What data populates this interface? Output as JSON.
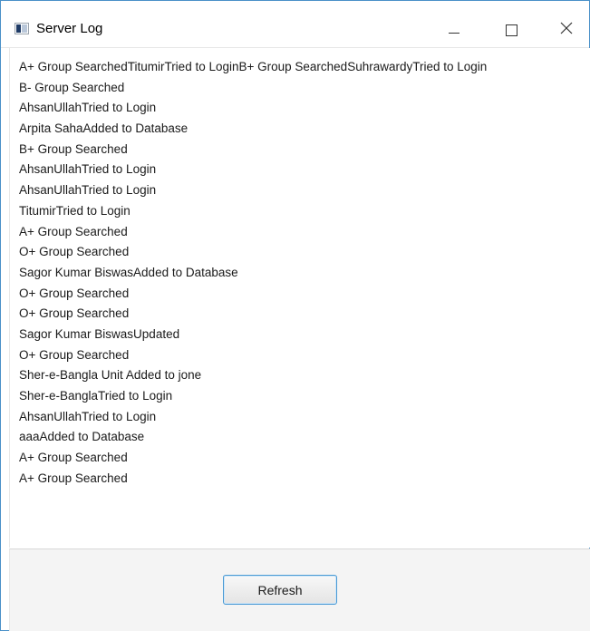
{
  "window": {
    "title": "Server Log"
  },
  "log": {
    "lines": [
      "A+ Group SearchedTitumirTried to LoginB+ Group SearchedSuhrawardyTried to Login",
      "B- Group Searched",
      "AhsanUllahTried to Login",
      "Arpita SahaAdded to Database",
      "B+ Group Searched",
      "AhsanUllahTried to Login",
      "AhsanUllahTried to Login",
      "TitumirTried to Login",
      "A+ Group Searched",
      "O+ Group Searched",
      "Sagor Kumar BiswasAdded to Database",
      "O+ Group Searched",
      "O+ Group Searched",
      "Sagor Kumar BiswasUpdated",
      "O+ Group Searched",
      "Sher-e-Bangla Unit Added to jone",
      "Sher-e-BanglaTried to Login",
      "AhsanUllahTried to Login",
      "aaaAdded to Database",
      "A+ Group Searched",
      "A+ Group Searched"
    ]
  },
  "actions": {
    "refresh_label": "Refresh"
  },
  "icons": {
    "app": "app-window-icon",
    "minimize": "minimize-icon",
    "maximize": "maximize-icon",
    "close": "close-icon"
  },
  "colors": {
    "window_border": "#4a90c8",
    "button_border": "#4a9ad4",
    "panel_background": "#f4f4f4"
  }
}
